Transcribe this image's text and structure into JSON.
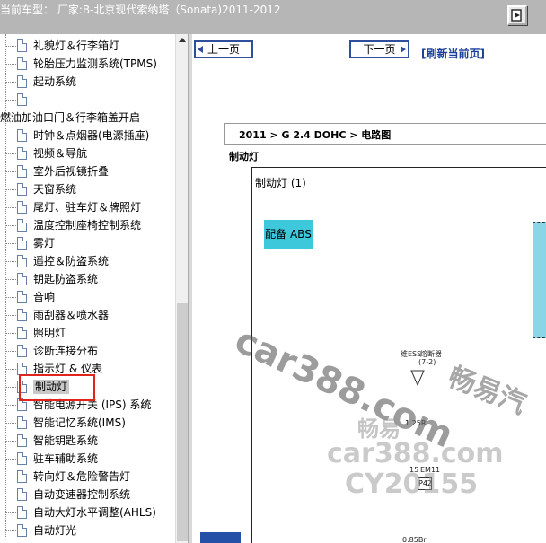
{
  "window": {
    "title": "当前车型： 厂家:B-北京现代索纳塔（Sonata)2011-2012"
  },
  "sidebar": {
    "items": [
      {
        "label": "礼貌灯＆行李箱灯",
        "type": "doc"
      },
      {
        "label": "轮胎压力监测系统(TPMS)",
        "type": "doc"
      },
      {
        "label": "起动系统",
        "type": "doc"
      },
      {
        "label": "",
        "type": "doc"
      },
      {
        "label": "燃油加油口门＆行李箱盖开启",
        "type": "folder"
      },
      {
        "label": "时钟＆点烟器(电源插座)",
        "type": "doc"
      },
      {
        "label": "视频＆导航",
        "type": "doc"
      },
      {
        "label": "室外后视镜折叠",
        "type": "doc"
      },
      {
        "label": "天窗系统",
        "type": "doc"
      },
      {
        "label": "尾灯、驻车灯＆牌照灯",
        "type": "doc"
      },
      {
        "label": "温度控制座椅控制系统",
        "type": "doc"
      },
      {
        "label": "雾灯",
        "type": "doc"
      },
      {
        "label": "遥控＆防盗系统",
        "type": "doc"
      },
      {
        "label": "钥匙防盗系统",
        "type": "doc"
      },
      {
        "label": "音响",
        "type": "doc"
      },
      {
        "label": "雨刮器＆喷水器",
        "type": "doc"
      },
      {
        "label": "照明灯",
        "type": "doc"
      },
      {
        "label": "诊断连接分布",
        "type": "doc"
      },
      {
        "label": "指示灯 & 仪表",
        "type": "doc"
      },
      {
        "label": "制动灯",
        "type": "doc",
        "selected": true
      },
      {
        "label": "智能电源开关 (IPS) 系统",
        "type": "doc"
      },
      {
        "label": "智能记忆系统(IMS)",
        "type": "doc"
      },
      {
        "label": "智能钥匙系统",
        "type": "doc"
      },
      {
        "label": "驻车辅助系统",
        "type": "doc"
      },
      {
        "label": "转向灯＆危险警告灯",
        "type": "doc"
      },
      {
        "label": "自动变速器控制系统",
        "type": "doc"
      },
      {
        "label": "自动大灯水平调整(AHLS)",
        "type": "doc"
      },
      {
        "label": "自动灯光",
        "type": "doc"
      }
    ]
  },
  "toolbar": {
    "prev_label": "上一页",
    "next_label": "下一页",
    "refresh_label": "[刷新当前页]"
  },
  "document": {
    "breadcrumb": "2011 > G 2.4 DOHC > 电路图",
    "section_title": "制动灯",
    "diagram_title": "制动灯 (1)",
    "abs_label": "配备 ABS",
    "wire_labels": {
      "ess": "维ESS",
      "fuse": "熔断器",
      "range": "(7-2)",
      "wire1": "1.25R",
      "conn": "15",
      "em": "EM11",
      "p42": "P42",
      "wire2": "0.85Br"
    },
    "watermarks": [
      "car388.com",
      "畅易汽",
      "畅易",
      "car388.com",
      "CY20155"
    ]
  },
  "colors": {
    "topbar": "#b6b6b6",
    "accent_blue": "#2f4e9c",
    "abs_box": "#3ec8dc",
    "highlight_red": "#e0241c"
  }
}
